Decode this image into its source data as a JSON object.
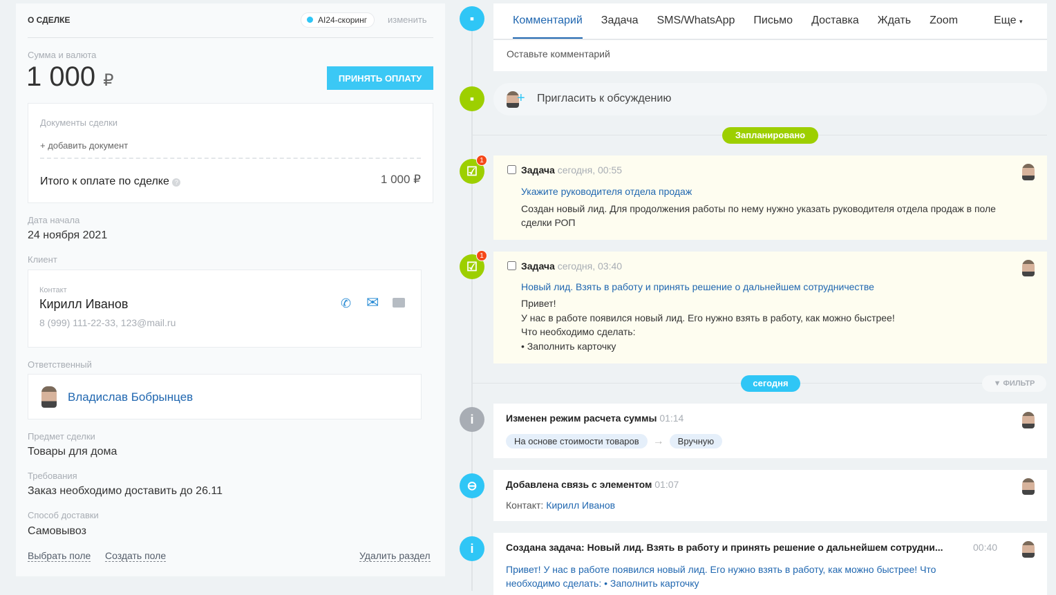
{
  "deal": {
    "title": "О СДЕЛКЕ",
    "scoring": "AI24-скоринг",
    "edit": "изменить",
    "sum_label": "Сумма и валюта",
    "sum": "1 000",
    "currency": "₽",
    "pay_button": "ПРИНЯТЬ ОПЛАТУ",
    "docs_label": "Документы сделки",
    "add_doc": "+ добавить документ",
    "total_label": "Итого к оплате по сделке",
    "total_value": "1 000 ₽",
    "start_label": "Дата начала",
    "start_value": "24 ноября 2021",
    "client_label": "Клиент",
    "contact_label": "Контакт",
    "contact_name": "Кирилл Иванов",
    "contact_info": "8 (999) 111-22-33, 123@mail.ru",
    "responsible_label": "Ответственный",
    "responsible_name": "Владислав Бобрынцев",
    "subject_label": "Предмет сделки",
    "subject_value": "Товары для дома",
    "req_label": "Требования",
    "req_value": "Заказ необходимо доставить до 26.11",
    "delivery_label": "Способ доставки",
    "delivery_value": "Самовывоз",
    "select_field": "Выбрать поле",
    "create_field": "Создать поле",
    "delete_section": "Удалить раздел"
  },
  "tabs": [
    "Комментарий",
    "Задача",
    "SMS/WhatsApp",
    "Письмо",
    "Доставка",
    "Ждать",
    "Zoom"
  ],
  "more_tab": "Еще",
  "comment_placeholder": "Оставьте комментарий",
  "invite": "Пригласить к обсуждению",
  "planned_label": "Запланировано",
  "today_label": "сегодня",
  "filter_label": "ФИЛЬТР",
  "tasks": [
    {
      "badge": "1",
      "title": "Задача",
      "time": "сегодня, 00:55",
      "link": "Укажите руководителя отдела продаж",
      "text": "Создан новый лид. Для продолжения работы по нему нужно указать руководителя отдела продаж в поле сделки РОП"
    },
    {
      "badge": "1",
      "title": "Задача",
      "time": "сегодня, 03:40",
      "link": "Новый лид. Взять в работу и принять решение о дальнейшем сотрудничестве",
      "lines": [
        "Привет!",
        "У нас в работе появился новый лид. Его нужно взять в работу, как можно быстрее!",
        "Что необходимо сделать:",
        "• Заполнить карточку"
      ]
    }
  ],
  "history": [
    {
      "title": "Изменен режим расчета суммы",
      "time": "01:14",
      "from": "На основе стоимости товаров",
      "to": "Вручную"
    },
    {
      "title": "Добавлена связь с элементом",
      "time": "01:07",
      "prefix": "Контакт:",
      "link": "Кирилл Иванов"
    },
    {
      "title": "Создана задача: Новый лид. Взять в работу и принять решение о дальнейшем сотрудни...",
      "time": "00:40",
      "text": "Привет! У нас в работе появился новый лид. Его нужно взять в работу, как можно быстрее! Что необходимо сделать: • Заполнить карточку"
    }
  ]
}
